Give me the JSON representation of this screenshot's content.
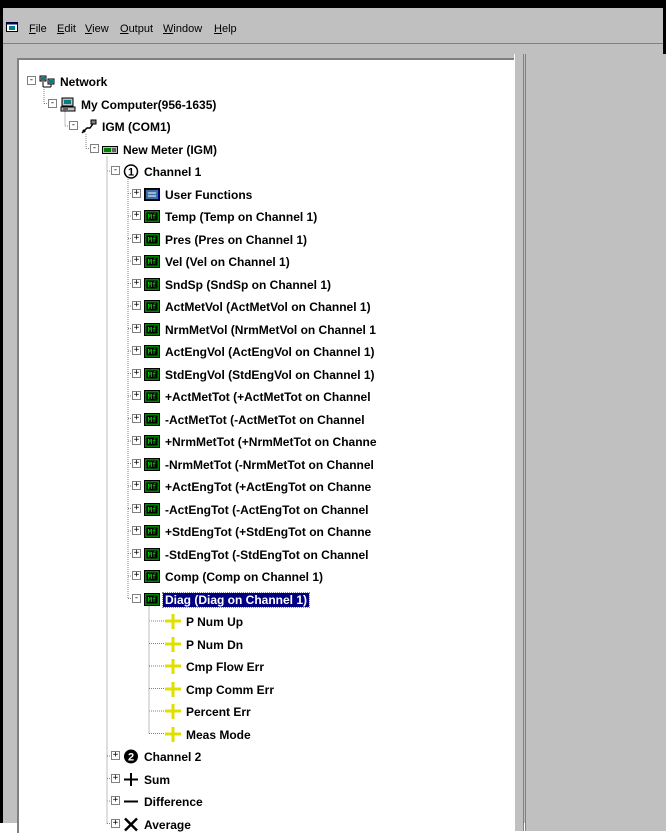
{
  "menubar": {
    "items": [
      {
        "label": "File",
        "u": "F",
        "rest": "ile"
      },
      {
        "label": "Edit",
        "u": "E",
        "rest": "dit"
      },
      {
        "label": "View",
        "u": "V",
        "rest": "iew"
      },
      {
        "label": "Output",
        "u": "O",
        "rest": "utput"
      },
      {
        "label": "Window",
        "u": "W",
        "rest": "indow"
      },
      {
        "label": "Help",
        "u": "H",
        "rest": "elp"
      }
    ]
  },
  "tree": {
    "network": "Network",
    "computer": "My Computer(956-1635)",
    "port": "IGM (COM1)",
    "meter": "New Meter (IGM)",
    "channel1": "Channel 1",
    "channel1_children": [
      "User Functions",
      "Temp (Temp on Channel 1)",
      "Pres (Pres on Channel 1)",
      "Vel (Vel on Channel 1)",
      "SndSp (SndSp on Channel 1)",
      "ActMetVol (ActMetVol on Channel 1)",
      "NrmMetVol (NrmMetVol on Channel 1",
      "ActEngVol (ActEngVol on Channel 1)",
      "StdEngVol (StdEngVol on Channel 1)",
      "+ActMetTot (+ActMetTot on Channel",
      "-ActMetTot (-ActMetTot on Channel",
      "+NrmMetTot (+NrmMetTot on Channe",
      "-NrmMetTot (-NrmMetTot on Channel",
      "+ActEngTot (+ActEngTot on Channe",
      "-ActEngTot (-ActEngTot on Channel",
      "+StdEngTot (+StdEngTot on Channe",
      "-StdEngTot (-StdEngTot on Channel",
      "Comp (Comp on Channel 1)",
      "Diag (Diag on Channel 1)"
    ],
    "diag_children": [
      "P Num Up",
      "P Num Dn",
      "Cmp Flow Err",
      "Cmp Comm Err",
      "Percent Err",
      "Meas Mode"
    ],
    "channel2": "Channel 2",
    "sum": "Sum",
    "difference": "Difference",
    "average": "Average"
  }
}
